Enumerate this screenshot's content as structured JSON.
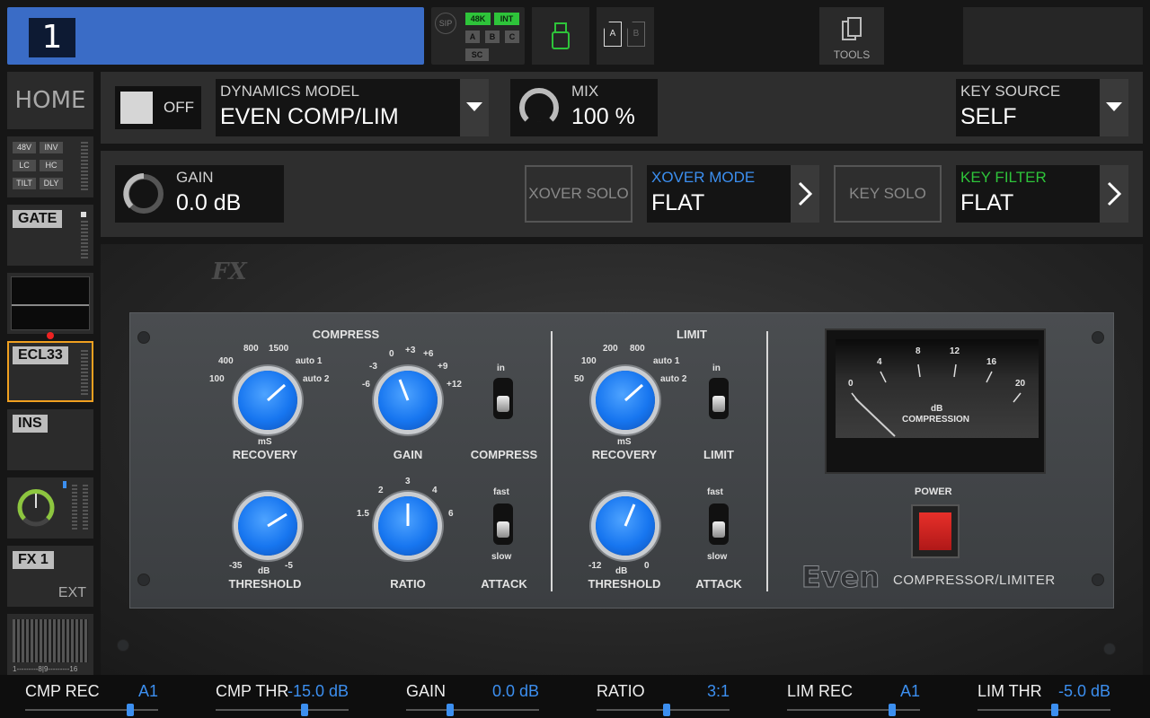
{
  "header": {
    "channel_number": "1",
    "clock": {
      "sip": "SIP",
      "rate": "48K",
      "source": "INT",
      "a": "A",
      "b": "B",
      "c": "C",
      "sc": "SC"
    },
    "scene_a": "A",
    "scene_b": "B",
    "tools_label": "TOOLS"
  },
  "sidebar": {
    "home": "HOME",
    "preamp_tags": [
      "48V",
      "INV",
      "LC",
      "HC",
      "TILT",
      "DLY"
    ],
    "gate": "GATE",
    "ecl": "ECL33",
    "ins": "INS",
    "fx": "FX 1",
    "ext": "EXT",
    "meter_scale": "1---------8|9---------16"
  },
  "dynamics": {
    "onoff": "OFF",
    "model_label": "DYNAMICS MODEL",
    "model_value": "EVEN COMP/LIM",
    "mix_label": "MIX",
    "mix_value": "100 %",
    "key_source_label": "KEY SOURCE",
    "key_source_value": "SELF",
    "gain_label": "GAIN",
    "gain_value": "0.0 dB",
    "xover_solo": "XOVER SOLO",
    "xover_mode_label": "XOVER MODE",
    "xover_mode_value": "FLAT",
    "key_solo": "KEY SOLO",
    "key_filter_label": "KEY FILTER",
    "key_filter_value": "FLAT"
  },
  "plugin": {
    "logo": "FX",
    "compress_title": "COMPRESS",
    "limit_title": "LIMIT",
    "recovery": "RECOVERY",
    "ms": "mS",
    "db": "dB",
    "gain": "GAIN",
    "compress": "COMPRESS",
    "limit": "LIMIT",
    "threshold": "THRESHOLD",
    "ratio": "RATIO",
    "attack": "ATTACK",
    "in": "in",
    "fast": "fast",
    "slow": "slow",
    "comp_recovery_scale": [
      "100",
      "400",
      "800",
      "1500",
      "auto 1",
      "auto 2"
    ],
    "gain_scale": [
      "-6",
      "-3",
      "0",
      "+3",
      "+6",
      "+9",
      "+12"
    ],
    "comp_threshold_scale": [
      "-35",
      "-5"
    ],
    "ratio_scale": [
      "1.5",
      "2",
      "3",
      "4",
      "6"
    ],
    "lim_recovery_scale": [
      "50",
      "100",
      "200",
      "800",
      "auto 1",
      "auto 2"
    ],
    "lim_threshold_scale": [
      "-12",
      "0"
    ],
    "meter_scale": [
      "0",
      "4",
      "8",
      "12",
      "16",
      "20"
    ],
    "meter_unit": "dB",
    "meter_label": "COMPRESSION",
    "power": "POWER",
    "brand": "Even",
    "product": "COMPRESSOR/LIMITER"
  },
  "params": [
    {
      "name": "CMP REC",
      "value": "A1",
      "position": 0.79
    },
    {
      "name": "CMP THR",
      "value": "-15.0 dB",
      "position": 0.67
    },
    {
      "name": "GAIN",
      "value": "0.0 dB",
      "position": 0.33
    },
    {
      "name": "RATIO",
      "value": "3:1",
      "position": 0.53
    },
    {
      "name": "LIM REC",
      "value": "A1",
      "position": 0.79
    },
    {
      "name": "LIM THR",
      "value": "-5.0 dB",
      "position": 0.58
    }
  ],
  "colors": {
    "accent": "#3c8ff0",
    "channel": "#3a6cc6",
    "selected": "#f0a020",
    "knob": "#1776f0",
    "key_filter": "#2ec43a"
  }
}
